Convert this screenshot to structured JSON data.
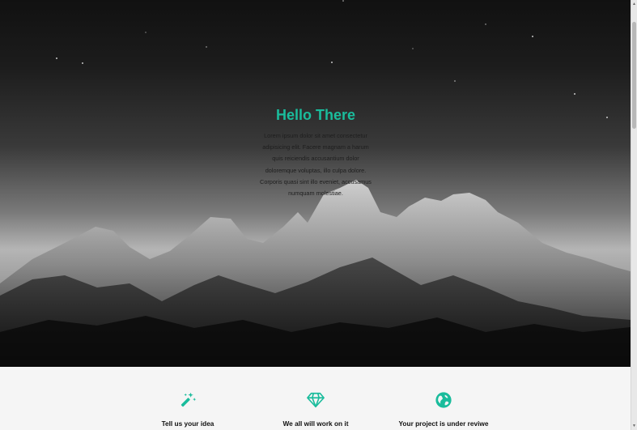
{
  "hero": {
    "title": "Hello There",
    "text": "Lorem ipsum dolor sit amet consectetur adipisicing elit. Facere magnam a harum quis reiciendis accusantium dolor doloremque voluptas, illo culpa dolore. Corporis quasi sint illo eveniet, accusamus numquam molestiae.",
    "accent_color": "#1abc9c"
  },
  "features": [
    {
      "icon": "magic-wand-icon",
      "label": "Tell us your idea"
    },
    {
      "icon": "diamond-icon",
      "label": "We all will work on it"
    },
    {
      "icon": "globe-icon",
      "label": "Your project is under reviwe"
    }
  ]
}
